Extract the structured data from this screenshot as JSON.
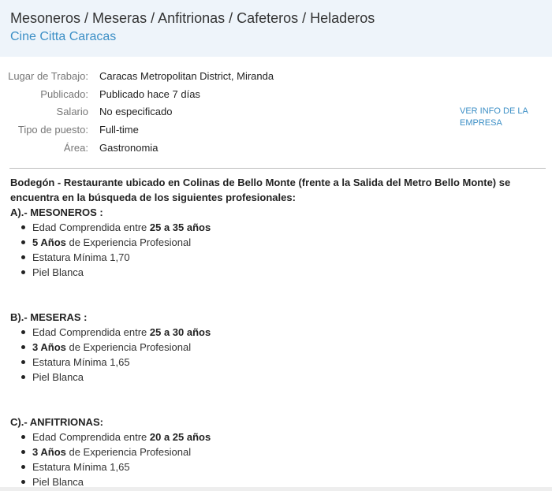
{
  "header": {
    "title": "Mesoneros / Meseras / Anfitrionas / Cafeteros / Heladeros",
    "company": "Cine Citta Caracas"
  },
  "details": [
    {
      "label": "Lugar de Trabajo:",
      "value": "Caracas Metropolitan District, Miranda"
    },
    {
      "label": "Publicado:",
      "value": "Publicado hace 7 días"
    },
    {
      "label": "Salario",
      "value": "No especificado"
    },
    {
      "label": "Tipo de puesto:",
      "value": "Full-time"
    },
    {
      "label": "Área:",
      "value": "Gastronomia"
    }
  ],
  "company_info_link": "VER INFO DE LA EMPRESA",
  "description": {
    "intro": "Bodegón - Restaurante ubicado en Colinas de Bello Monte (frente a la Salida del Metro Bello Monte) se encuentra en la búsqueda de los siguientes profesionales:",
    "sections": [
      {
        "title": "A).- MESONEROS :",
        "age_prefix": "Edad Comprendida entre ",
        "age_bold": "25 a 35 años",
        "exp_bold": "5 Años",
        "exp_suffix": " de Experiencia Profesional",
        "height": "Estatura Mínima 1,70",
        "skin": "Piel Blanca"
      },
      {
        "title": "B).- MESERAS :",
        "age_prefix": "Edad Comprendida entre ",
        "age_bold": "25 a 30 años",
        "exp_bold": "3 Años",
        "exp_suffix": " de Experiencia Profesional",
        "height": "Estatura Mínima 1,65",
        "skin": "Piel Blanca"
      },
      {
        "title": "C).- ANFITRIONAS:",
        "age_prefix": "Edad Comprendida entre ",
        "age_bold": "20 a 25 años",
        "exp_bold": "3 Años",
        "exp_suffix": " de Experiencia Profesional",
        "height": "Estatura Mínima 1,65",
        "skin": "Piel Blanca"
      }
    ]
  },
  "colors": {
    "header_bg": "#eef4fa",
    "link": "#3c8fc6",
    "label": "#777777",
    "divider": "#bdbdbd"
  }
}
